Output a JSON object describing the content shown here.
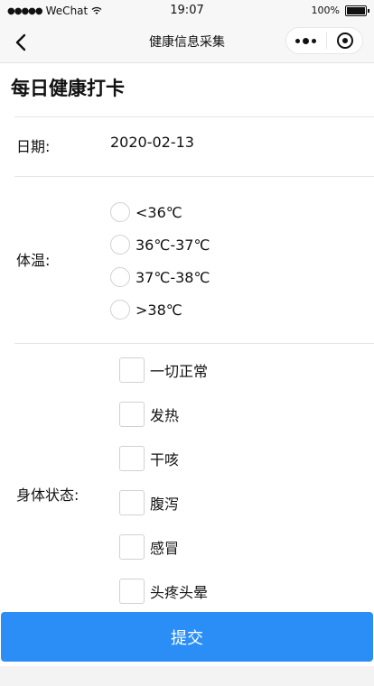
{
  "status_bar": {
    "signal": "●●●●●",
    "carrier": "WeChat",
    "time": "19:07",
    "battery": "100%"
  },
  "nav": {
    "title": "健康信息采集"
  },
  "page": {
    "title": "每日健康打卡"
  },
  "form": {
    "date_label": "日期:",
    "date_value": "2020-02-13",
    "temperature_label": "体温:",
    "temperature_options": [
      "<36℃",
      "36℃-37℃",
      "37℃-38℃",
      ">38℃"
    ],
    "condition_label": "身体状态:",
    "condition_options": [
      "一切正常",
      "发热",
      "干咳",
      "腹泻",
      "感冒",
      "头疼头晕"
    ]
  },
  "submit_label": "提交",
  "colors": {
    "accent": "#2b8ef7"
  }
}
